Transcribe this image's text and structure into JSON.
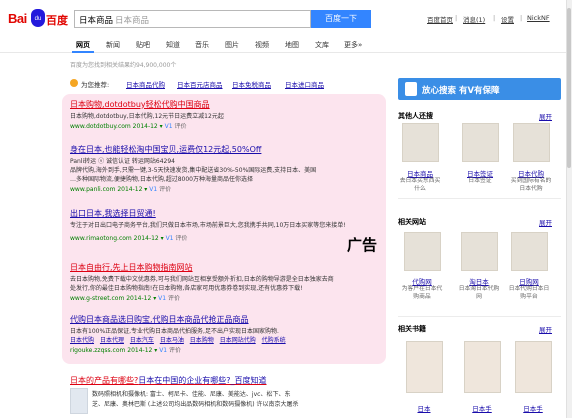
{
  "header": {
    "logo_bai": "Bai",
    "logo_du": "du",
    "logo_cn": "百度",
    "query": "日本商品",
    "query_ghost": "日本商品",
    "search_button": "百度一下",
    "links": [
      "百度首页",
      "消息(1)",
      "设置",
      "NickNF"
    ],
    "separators": [
      "|",
      "|",
      "|"
    ]
  },
  "tabs": [
    "网页",
    "新闻",
    "贴吧",
    "知道",
    "音乐",
    "图片",
    "视频",
    "地图",
    "文库",
    "更多»"
  ],
  "result_count": "百度为您找到相关结果约94,900,000个",
  "recommend": {
    "label": "为您推荐:",
    "links": [
      "日本商品代购",
      "日本百元店商品",
      "日本免税商品",
      "日本进口商品"
    ]
  },
  "ads": [
    {
      "title": "日本购物,dotdotbuy轻松代购中国商品",
      "desc": [
        "日本购物,dotdotbuy,日本代购,12元节日运费立减12元起"
      ],
      "url": "www.dotdotbuy.com  2014-12 ▾",
      "rate": "评价",
      "tag": "V1"
    },
    {
      "title": "身在日本,也能轻松淘中国宝贝,运费仅12元起,50%Off",
      "desc": [
        "Panli转运 ⓥ 诚信认证 转运网站64294",
        "品牌代购,海外到手,只需一键,3-5天快速发货,集中配送省30%-50%国际运费,支持日本、美国",
        "…多种国际物流,便捷购物,日本代购,超过8000万种海量商品任你选择"
      ],
      "url": "www.panli.com  2014-12 ▾",
      "rate": "评价",
      "tag": "V1"
    },
    {
      "title": "出口日本,我选择日贸通!",
      "desc": [
        "专注于对日出口电子商务平台,我们只做日本市场,市场前景巨大,您我携手共同,10万日本买家等您来接单!"
      ],
      "url": "www.rimaotong.com  2014-12 ▾",
      "rate": "评价",
      "tag": "V1"
    },
    {
      "title": "日本自由行,先上日本购物指南网站",
      "desc": [
        "去日本购物,免费下载中文优惠券,可与我们网站互相享受额外折扣,日本的购物导游是全日本独家去商",
        "处发行,你的最佳日本购物指南!在日本购物,各店家可用优惠券卷到实现,还有优惠券下载!"
      ],
      "url": "www.g-street.com  2014-12 ▾",
      "rate": "评价",
      "tag": "V1"
    },
    {
      "title": "代购日本商品选日购宝,代购日本商品代抢正品商品",
      "desc": [
        "日本有100%正品保证,专业代购日本商品代拍服务,足不出户实现日本国家购物."
      ],
      "links": [
        "日本代购",
        "日本代理",
        "日本汽车",
        "日本马油",
        "日本购物",
        "日本网站代购",
        "代购系统"
      ],
      "url": "rigouke.zzqss.com  2014-12 ▾",
      "rate": "评价",
      "tag": "V1"
    }
  ],
  "ad_label": "广告",
  "organic": {
    "title_red": "日本的产品有哪些?",
    "title_blue": "日本在中国的企业有哪些?",
    "title_tail": "_百度知道",
    "desc": [
      "数码照相机和摄像机:      富士、柯尼卡、佳能、尼康、美能达、jvc、松下、东",
      "芝、尼康、奥林巴斯 (上述公司均出品数码相机和数码摄像机) 许以南京大屠杀"
    ]
  },
  "right": {
    "relief_text": "放心搜索  有V有保障",
    "sections": [
      {
        "title": "其他人还搜",
        "more": "展开",
        "items": [
          {
            "cap": "日本商品",
            "sub": "去日本买东西买什么"
          },
          {
            "cap": "日本签证",
            "sub": "日本签证"
          },
          {
            "cap": "日本代购",
            "sub": "买到国际有名的日本代购"
          }
        ]
      },
      {
        "title": "相关网站",
        "more": "展开",
        "items": [
          {
            "cap": "代购网",
            "sub": "为客户在日本代购商品"
          },
          {
            "cap": "淘日本",
            "sub": "日本淘日本代购网"
          },
          {
            "cap": "日购网",
            "sub": "日本代购日本日购平台"
          }
        ]
      },
      {
        "title": "相关书籍",
        "more": "展开",
        "items": [
          {
            "cap": "日本",
            "sub": ""
          },
          {
            "cap": "日本手",
            "sub": ""
          },
          {
            "cap": "日本手",
            "sub": ""
          }
        ]
      }
    ]
  },
  "colors": {
    "accent": "#3385ff",
    "ad_bg": "#fce4ee",
    "ad_title": "#dd1111",
    "link_blue": "#1a0dab",
    "url_green": "#008000"
  }
}
